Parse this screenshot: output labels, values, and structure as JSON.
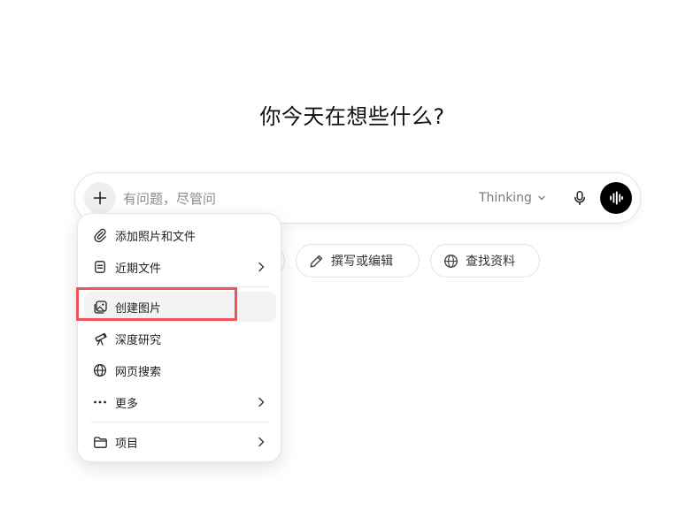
{
  "heading": "你今天在想些什么?",
  "composer": {
    "placeholder": "有问题，尽管问",
    "model_label": "Thinking",
    "icons": {
      "add": "plus-icon",
      "model": "chevron-down-icon",
      "mic": "microphone-icon",
      "voice": "voice-waveform-icon"
    }
  },
  "chips": [
    {
      "label": "撰写或编辑",
      "icon": "pencil-icon"
    },
    {
      "label": "查找资料",
      "icon": "globe-icon"
    }
  ],
  "menu": {
    "items": [
      {
        "label": "添加照片和文件",
        "icon": "paperclip-icon",
        "submenu": false
      },
      {
        "label": "近期文件",
        "icon": "document-icon",
        "submenu": true
      },
      {
        "label": "创建图片",
        "icon": "image-icon",
        "submenu": false,
        "highlighted": true
      },
      {
        "label": "深度研究",
        "icon": "telescope-icon",
        "submenu": false
      },
      {
        "label": "网页搜索",
        "icon": "globe-icon",
        "submenu": false
      },
      {
        "label": "更多",
        "icon": "more-dots-icon",
        "submenu": true
      },
      {
        "label": "项目",
        "icon": "folder-icon",
        "submenu": true
      }
    ]
  },
  "colors": {
    "highlight_border": "#f0545b",
    "voice_button": "#000000",
    "hover_bg": "#f3f3f3"
  }
}
